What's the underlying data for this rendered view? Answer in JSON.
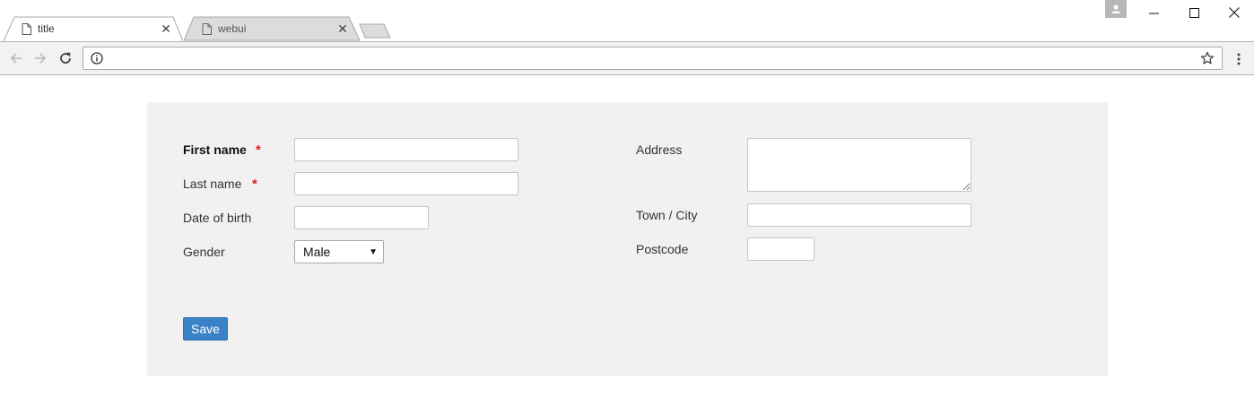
{
  "browser": {
    "tabs": [
      {
        "label": "title",
        "active": true
      },
      {
        "label": "webui",
        "active": false
      }
    ],
    "close_glyph": "✕",
    "address": {
      "value": ""
    },
    "icons": {
      "page": "page-icon",
      "back": "back-arrow-icon",
      "forward": "forward-arrow-icon",
      "reload": "reload-icon",
      "info": "info-icon",
      "star": "star-icon",
      "menu": "kebab-menu-icon",
      "profile": "profile-icon"
    }
  },
  "form": {
    "first_name": {
      "label": "First name",
      "required_mark": "*",
      "value": ""
    },
    "last_name": {
      "label": "Last name",
      "required_mark": "*",
      "value": ""
    },
    "date_of_birth": {
      "label": "Date of birth",
      "value": ""
    },
    "gender": {
      "label": "Gender",
      "selected": "Male",
      "arrow": "▼"
    },
    "address": {
      "label": "Address",
      "value": ""
    },
    "town_city": {
      "label": "Town / City",
      "value": ""
    },
    "postcode": {
      "label": "Postcode",
      "value": ""
    },
    "save_label": "Save"
  },
  "colors": {
    "panel_bg": "#f1f1f1",
    "required": "#e02020",
    "save_button": "#3a82c8"
  }
}
